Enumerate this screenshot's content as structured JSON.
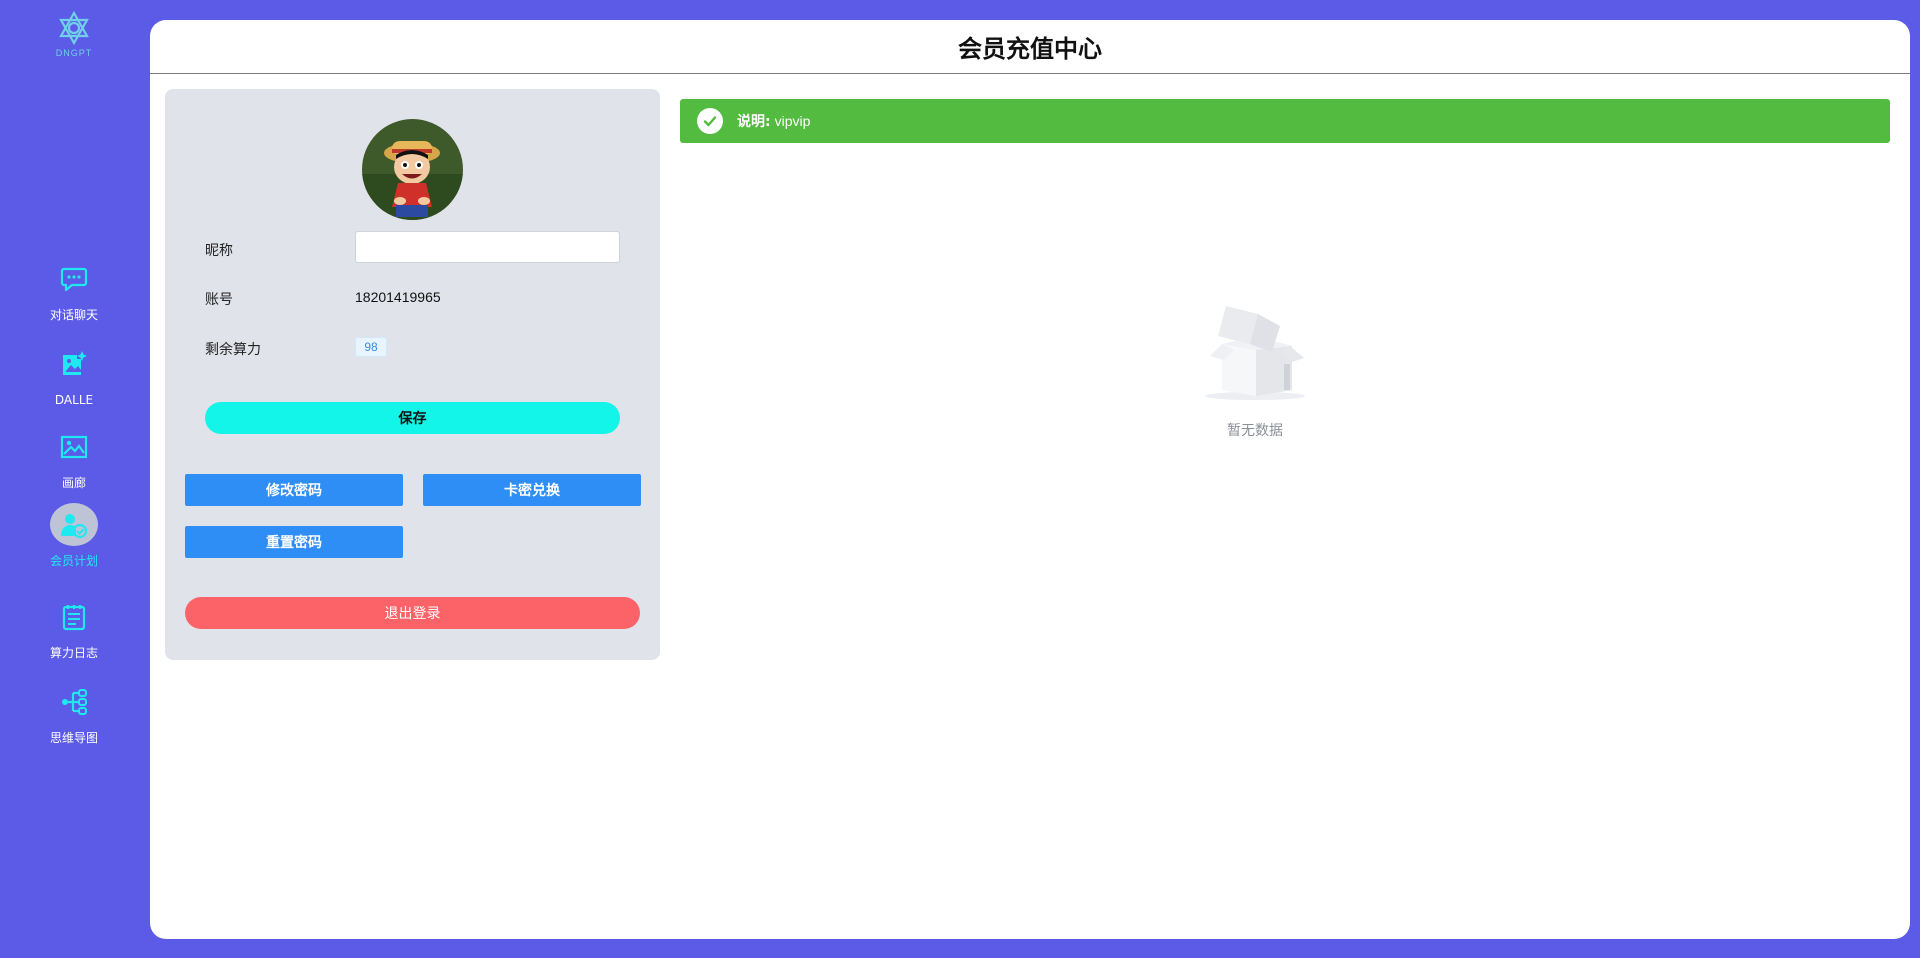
{
  "sidebar": {
    "logo_text": "DNGPT",
    "items": [
      {
        "label": "对话聊天",
        "icon": "chat-icon"
      },
      {
        "label": "DALLE",
        "icon": "image-sparkle-icon"
      },
      {
        "label": "画廊",
        "icon": "gallery-icon"
      },
      {
        "label": "会员计划",
        "icon": "member-icon",
        "active": true
      },
      {
        "label": "算力日志",
        "icon": "log-icon"
      },
      {
        "label": "思维导图",
        "icon": "mindmap-icon"
      }
    ],
    "accent_color": "#20e8f0"
  },
  "header": {
    "title": "会员充值中心"
  },
  "profile": {
    "nickname_label": "昵称",
    "nickname_value": "",
    "account_label": "账号",
    "account_value": "18201419965",
    "power_label": "剩余算力",
    "power_value": "98",
    "save_label": "保存",
    "change_password_label": "修改密码",
    "card_redeem_label": "卡密兑换",
    "reset_password_label": "重置密码",
    "logout_label": "退出登录"
  },
  "notice": {
    "label": "说明:",
    "text": "vipvip"
  },
  "empty": {
    "text": "暂无数据"
  },
  "colors": {
    "background": "#5b5be7",
    "save_button": "#12f5e8",
    "primary_button": "#2f8ef5",
    "logout_button": "#fc6368",
    "notice": "#52bb40"
  }
}
